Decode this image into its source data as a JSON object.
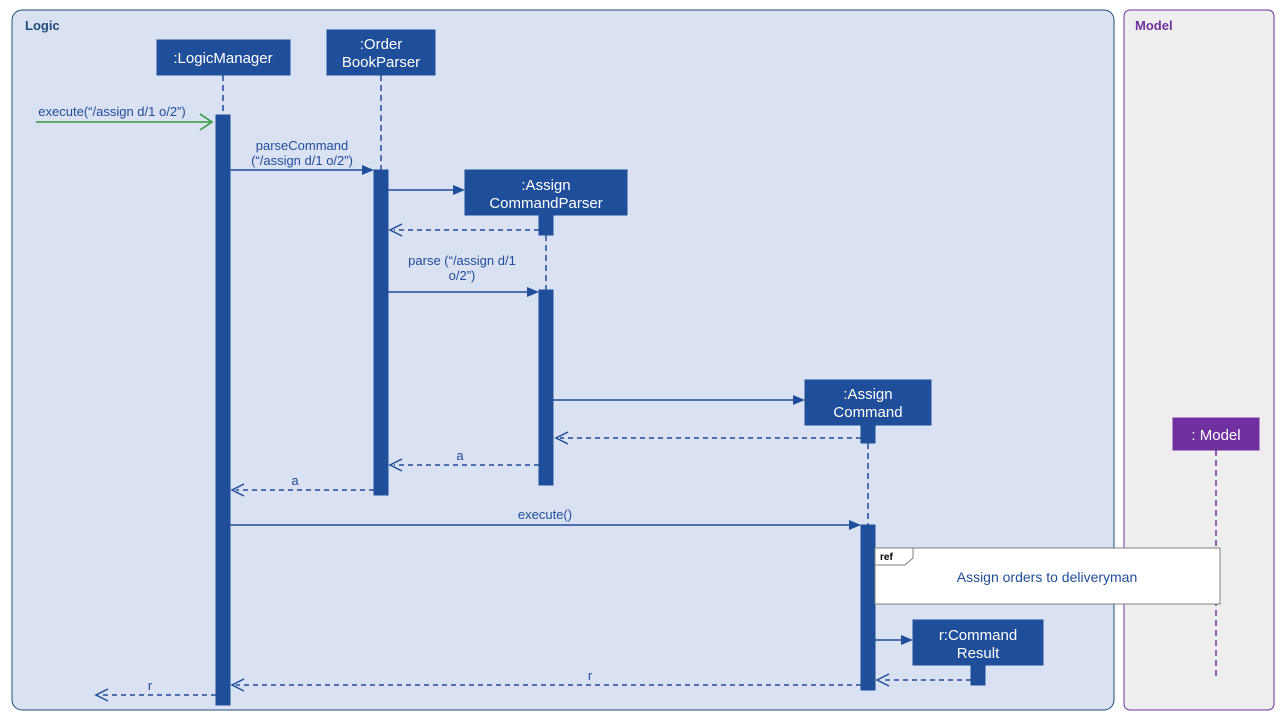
{
  "type": "uml_sequence_diagram",
  "frames": {
    "logic": {
      "label": "Logic"
    },
    "model": {
      "label": "Model"
    }
  },
  "participants": {
    "logicManager": {
      "line1": ":LogicManager"
    },
    "orderBookParser": {
      "line1": ":Order",
      "line2": "BookParser"
    },
    "assignCommandParser": {
      "line1": ":Assign",
      "line2": "CommandParser"
    },
    "assignCommand": {
      "line1": ":Assign",
      "line2": "Command"
    },
    "commandResult": {
      "line1": "r:Command",
      "line2": "Result"
    },
    "model": {
      "line1": ": Model"
    }
  },
  "messages": {
    "executeIn": "execute(“/assign d/1 o/2”)",
    "parseCommand1": "parseCommand",
    "parseCommand2": "(“/assign d/1 o/2”)",
    "parse1": "parse (“/assign d/1",
    "parse2": "o/2”)",
    "a": "a",
    "execute": "execute()",
    "r": "r"
  },
  "ref": {
    "tab": "ref",
    "text": "Assign orders to deliveryman"
  }
}
